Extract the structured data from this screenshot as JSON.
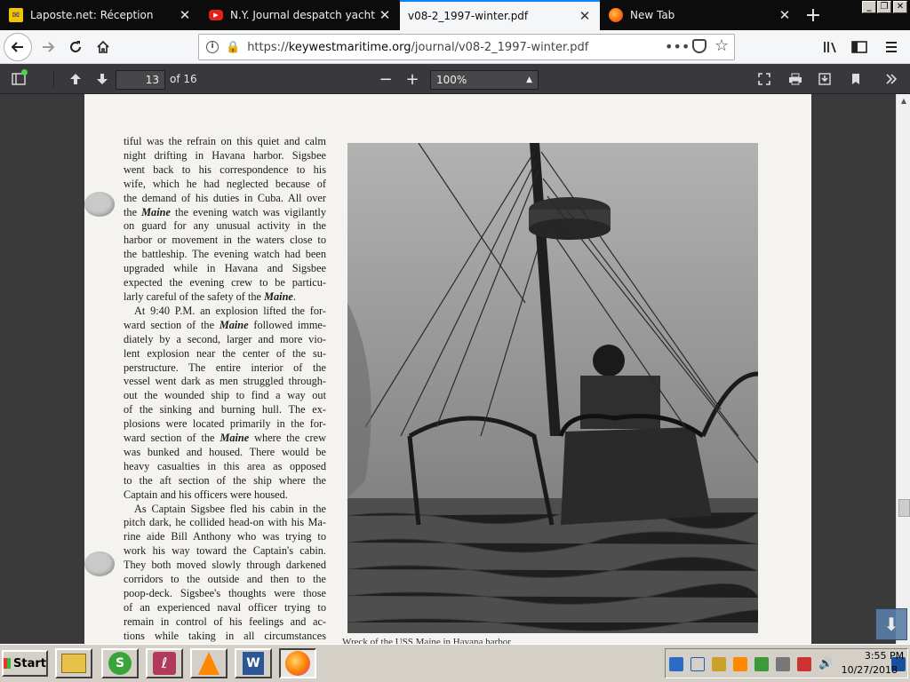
{
  "tabs": [
    {
      "title": "Laposte.net: Réception",
      "icon": "laposte-icon",
      "active": false
    },
    {
      "title": "N.Y. Journal despatch yacht \"Buc",
      "icon": "youtube-icon",
      "active": false
    },
    {
      "title": "v08-2_1997-winter.pdf",
      "icon": "",
      "active": true
    },
    {
      "title": "New Tab",
      "icon": "firefox-icon",
      "active": false
    }
  ],
  "urlbar": {
    "scheme": "https://",
    "host": "keywestmaritime.org",
    "path": "/journal/v08-2_1997-winter.pdf"
  },
  "pdf_toolbar": {
    "page_number": "13",
    "page_count_label": "of 16",
    "zoom": "100%"
  },
  "article_lines": [
    {
      "t": "tiful was the refrain on this quiet and calm",
      "ind": false
    },
    {
      "t": "night drifting in Havana harbor.  Sigsbee",
      "ind": false
    },
    {
      "t": "went back to his correspondence to his",
      "ind": false
    },
    {
      "t": "wife, which he had neglected because of",
      "ind": false
    },
    {
      "t": "the demand of his duties in Cuba.  All over",
      "ind": false
    },
    {
      "t": "the Maine the evening watch was vigilantly",
      "ind": false
    },
    {
      "t": "on guard for any unusual activity in the",
      "ind": false
    },
    {
      "t": "harbor or movement in the waters close to",
      "ind": false
    },
    {
      "t": "the battleship.  The evening watch had been",
      "ind": false
    },
    {
      "t": "upgraded while in Havana and Sigsbee",
      "ind": false
    },
    {
      "t": "expected the evening crew to be particu-",
      "ind": false
    },
    {
      "t": "larly careful of the safety of the Maine.",
      "ind": false,
      "last": true
    },
    {
      "t": "At 9:40 P.M. an explosion lifted the for-",
      "ind": true
    },
    {
      "t": "ward section of the Maine followed imme-",
      "ind": false
    },
    {
      "t": "diately by a second, larger and more vio-",
      "ind": false
    },
    {
      "t": "lent explosion near the center of the su-",
      "ind": false
    },
    {
      "t": "perstructure.  The entire interior of the",
      "ind": false
    },
    {
      "t": "vessel went dark as men struggled through-",
      "ind": false
    },
    {
      "t": "out the wounded ship to find a way out",
      "ind": false
    },
    {
      "t": "of the sinking and burning hull.  The ex-",
      "ind": false
    },
    {
      "t": "plosions were located primarily in the for-",
      "ind": false
    },
    {
      "t": "ward section of the Maine where the crew",
      "ind": false
    },
    {
      "t": "was bunked and housed.  There would be",
      "ind": false
    },
    {
      "t": "heavy casualties in this area as opposed",
      "ind": false
    },
    {
      "t": "to the aft section of the ship where the",
      "ind": false
    },
    {
      "t": "Captain and his officers were housed.",
      "ind": false,
      "last": true
    },
    {
      "t": "As Captain Sigsbee fled his cabin in the",
      "ind": true
    },
    {
      "t": "pitch dark, he collided head-on with his Ma-",
      "ind": false
    },
    {
      "t": "rine aide Bill Anthony who was trying to",
      "ind": false
    },
    {
      "t": "work his way toward the Captain's cabin.",
      "ind": false
    },
    {
      "t": "They both moved slowly through darkened",
      "ind": false
    },
    {
      "t": "corridors to the outside and then to the",
      "ind": false
    },
    {
      "t": "poop-deck.  Sigsbee's thoughts were those",
      "ind": false
    },
    {
      "t": "of an experienced naval officer trying to",
      "ind": false
    },
    {
      "t": "remain in control of his feelings and ac-",
      "ind": false
    },
    {
      "t": "tions while taking in all circumstances",
      "ind": false
    }
  ],
  "caption_partial": "Wreck of the USS Maine in Havana harbor",
  "taskbar": {
    "start_label": "Start",
    "apps": [
      "explorer",
      "skype",
      "pdf-reader",
      "vlc",
      "word",
      "firefox"
    ]
  },
  "clock": {
    "time": "3:55 PM",
    "date": "10/27/2018"
  },
  "colors": {
    "accent": "#0a84ff",
    "tabbar": "#0c0c0d",
    "pdf_toolbar": "#38383d",
    "taskbar": "#d4d0c8"
  }
}
